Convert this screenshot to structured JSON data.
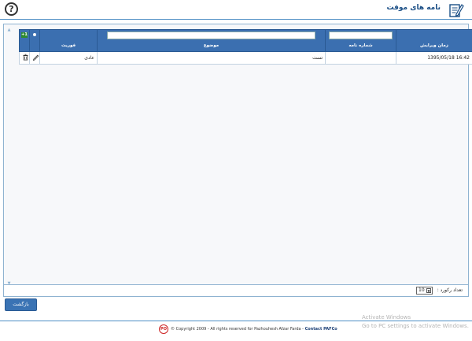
{
  "header": {
    "title": "نامه های موقت",
    "help_label": "?"
  },
  "grid": {
    "columns": {
      "date": "زمان ویرایش",
      "letter_no": "شماره نامه",
      "subject": "موضوع",
      "priority": "فوریت",
      "check_badge": "+1"
    },
    "rows": [
      {
        "date": "16:42 1395/05/18",
        "letter_no": "",
        "subject": "تست",
        "priority": "عادی"
      }
    ],
    "filters": {
      "letter_no": "",
      "subject": ""
    }
  },
  "pager": {
    "label": "تعداد رکورد :",
    "page_size": "10"
  },
  "buttons": {
    "back": "بازگشت"
  },
  "footer": {
    "logo_text": "PO",
    "copyright": "© Copyright 2009 - All rights reserved for Pazhouhesh Afzar Farda -",
    "contact": "Contact PAFCo"
  },
  "watermark": {
    "line1": "Activate Windows",
    "line2": "Go to PC settings to activate Windows."
  },
  "colors": {
    "accent": "#3b6fb0",
    "header_border": "#4f8fc5",
    "title": "#1b4f86"
  },
  "icons": {
    "header": "edit-document-icon",
    "delete": "trash-icon",
    "edit": "pencil-icon"
  }
}
